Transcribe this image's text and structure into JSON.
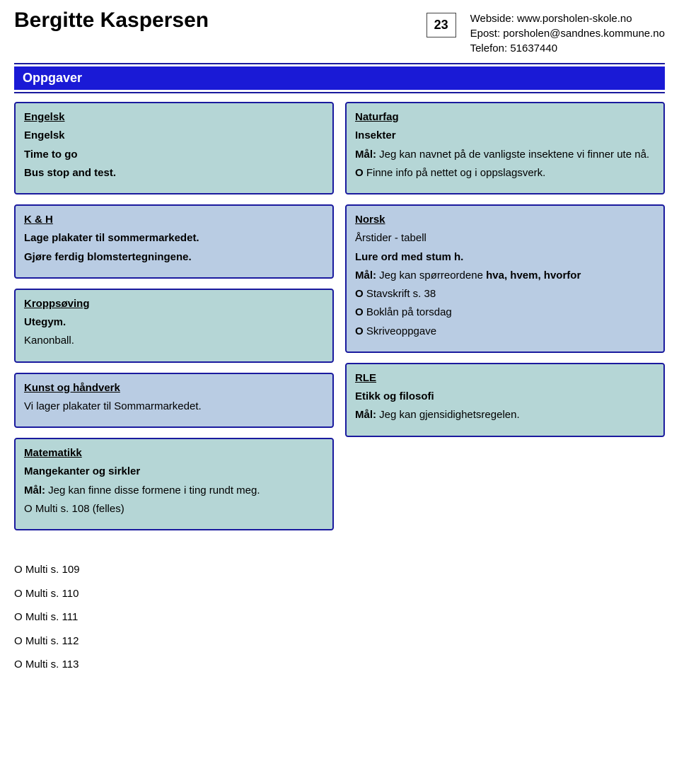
{
  "header": {
    "name": "Bergitte Kaspersen",
    "badge": "23",
    "webLabel": "Webside:",
    "web": "www.porsholen-skole.no",
    "emailLabel": "Epost:",
    "email": "porsholen@sandnes.kommune.no",
    "phoneLabel": "Telefon:",
    "phone": "51637440"
  },
  "banner": "Oppgaver",
  "left": {
    "engelsk": {
      "heading": "Engelsk",
      "sub": "Engelsk",
      "l1": "Time to go",
      "l2": "Bus stop and test."
    },
    "kh": {
      "heading": "K & H",
      "l1": "Lage plakater til sommermarkedet.",
      "l2": "Gjøre ferdig blomstertegningene."
    },
    "kropp": {
      "heading": "Kroppsøving",
      "l1": "Utegym.",
      "l2": "Kanonball."
    },
    "kunst": {
      "heading": "Kunst og håndverk",
      "l1": "Vi lager plakater til Sommarmarkedet."
    },
    "matte": {
      "heading": "Matematikk",
      "sub": "Mangekanter og sirkler",
      "goalLabel": "Mål:",
      "goal": " Jeg kan finne disse formene i ting rundt meg.",
      "o1": "O Multi s. 108 (felles)",
      "o2": "O Multi s. 109",
      "o3": "O Multi s. 110",
      "o4": "O Multi s. 111",
      "o5": "O Multi s. 112",
      "o6": "O Multi s. 113"
    }
  },
  "right": {
    "natur": {
      "heading": "Naturfag",
      "sub": "Insekter",
      "goalLabel": "Mål:",
      "goal": " Jeg kan navnet på de vanligste insektene vi finner ute nå.",
      "o1Label": "O",
      "o1": " Finne info på nettet og i oppslagsverk."
    },
    "norsk": {
      "heading": "Norsk",
      "l1": "Årstider - tabell",
      "l2": "Lure ord med stum h.",
      "goalLabel": "Mål:",
      "goal1": " Jeg kan spørreordene ",
      "goal2": "hva, hvem, hvorfor",
      "o1Label": "O",
      "o1": " Stavskrift s. 38",
      "o2Label": "O",
      "o2": " Boklån på torsdag",
      "o3Label": "O",
      "o3": " Skriveoppgave"
    },
    "rle": {
      "heading": "RLE",
      "sub": "Etikk og filosofi",
      "goalLabel": "Mål:",
      "goal": " Jeg kan gjensidighetsregelen."
    }
  }
}
